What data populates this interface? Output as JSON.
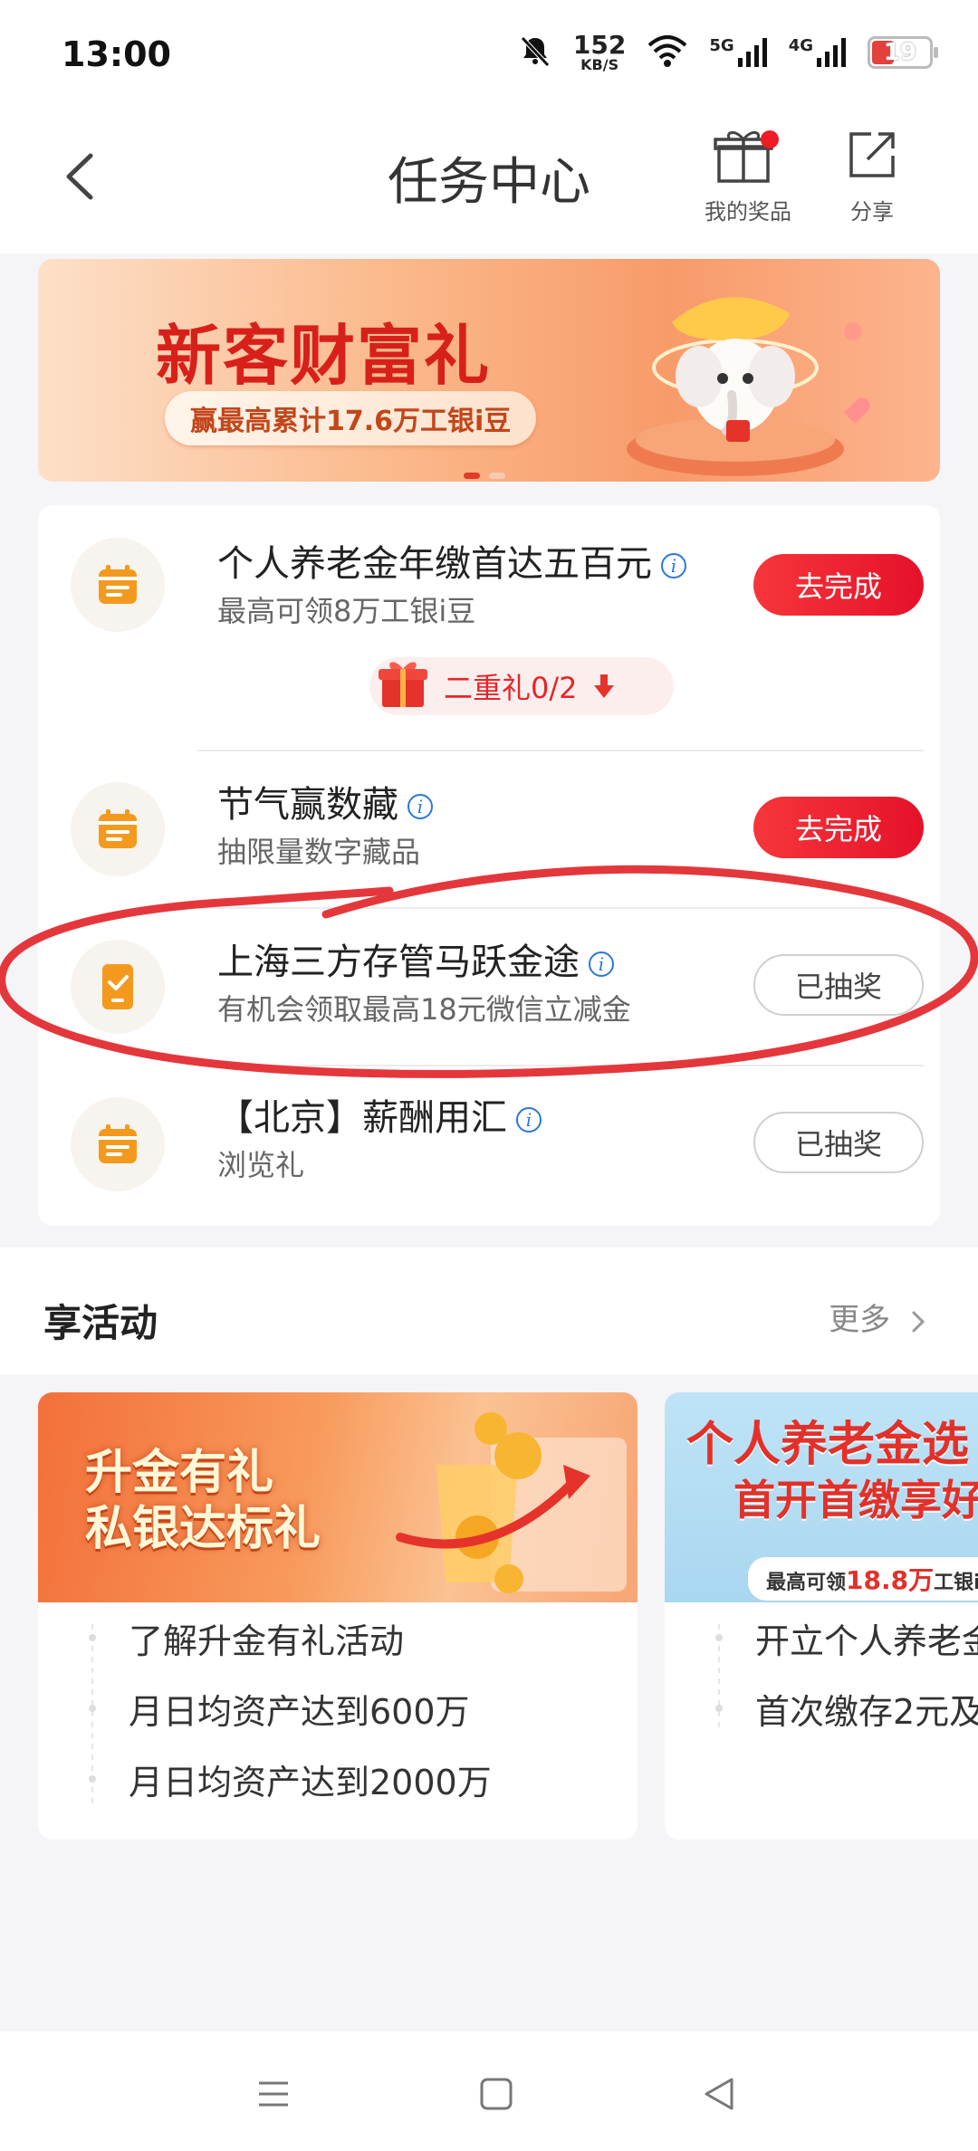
{
  "status_bar": {
    "time": "13:00",
    "net_speed": "152",
    "net_unit": "KB/S",
    "signal1": "5G",
    "signal2": "4G",
    "battery": "19",
    "icons": [
      "mute-bell-icon",
      "wifi-icon",
      "signal-5g-icon",
      "signal-4g-icon",
      "battery-icon"
    ]
  },
  "header": {
    "title": "任务中心",
    "prizes_label": "我的奖品",
    "share_label": "分享"
  },
  "banner": {
    "title": "新客财富礼",
    "pill": "赢最高累计17.6万工银i豆",
    "dots": 2,
    "active_dot": 0
  },
  "tasks": [
    {
      "title": "个人养老金年缴首达五百元",
      "subtitle": "最高可领8万工银i豆",
      "button": "去完成",
      "button_style": "primary",
      "icon": "calendar-icon",
      "gift_label": "二重礼0/2"
    },
    {
      "title": "节气赢数藏",
      "subtitle": "抽限量数字藏品",
      "button": "去完成",
      "button_style": "primary",
      "icon": "calendar-icon"
    },
    {
      "title": "上海三方存管马跃金途",
      "subtitle": "有机会领取最高18元微信立减金",
      "button": "已抽奖",
      "button_style": "secondary",
      "icon": "phone-check-icon"
    },
    {
      "title": "【北京】薪酬用汇",
      "subtitle": "浏览礼",
      "button": "已抽奖",
      "button_style": "secondary",
      "icon": "calendar-icon"
    }
  ],
  "info_glyph": "i",
  "activities": {
    "heading": "享活动",
    "more": "更多",
    "cards": [
      {
        "image_title_line1": "升金有礼",
        "image_title_line2": "私银达标礼",
        "items": [
          "了解升金有礼活动",
          "月日均资产达到600万",
          "月日均资产达到2000万"
        ]
      },
      {
        "image_title_line1": "个人养老金选",
        "image_title_line2": "首开首缴享好",
        "image_pill_prefix": "最高可领",
        "image_pill_highlight": "18.8万",
        "image_pill_suffix": "工银i",
        "items": [
          "开立个人养老金",
          "首次缴存2元及"
        ]
      }
    ]
  },
  "colors": {
    "primary_red": "#e5112a",
    "info_blue": "#2b78d8",
    "icon_orange": "#f39a1e",
    "annotation_red": "#e4373c"
  },
  "nav": [
    "menu-icon",
    "home-square-icon",
    "back-triangle-icon"
  ]
}
